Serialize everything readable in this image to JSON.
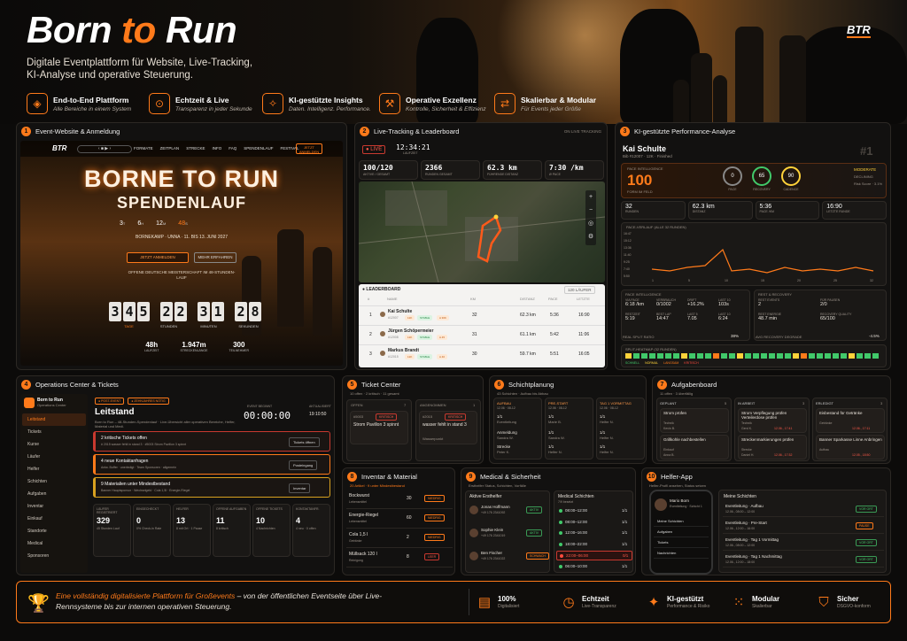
{
  "header": {
    "title_a": "Born ",
    "title_b": "to",
    "title_c": " Run",
    "subtitle": "Digitale Eventplattform für Website, Live-Tracking, KI-Analyse und operative Steuerung.",
    "logo": "BTR",
    "features": [
      {
        "icon": "layers-icon",
        "glyph": "◈",
        "title": "End-to-End Plattform",
        "sub": "Alle Bereiche in einem System"
      },
      {
        "icon": "live-icon",
        "glyph": "⊙",
        "title": "Echtzeit & Live",
        "sub": "Transparenz in jeder Sekunde"
      },
      {
        "icon": "ai-icon",
        "glyph": "✧",
        "title": "KI-gestützte Insights",
        "sub": "Daten. Intelligenz. Performance."
      },
      {
        "icon": "tools-icon",
        "glyph": "⚒",
        "title": "Operative Exzellenz",
        "sub": "Kontrolle, Sicherheit & Effizienz"
      },
      {
        "icon": "scale-icon",
        "glyph": "⇄",
        "title": "Skalierbar & Modular",
        "sub": "Für Events jeder Größe"
      }
    ]
  },
  "p1": {
    "num": "1",
    "title": "Event-Website & Anmeldung",
    "logo": "BTR",
    "nav": [
      "FORMATE",
      "ZEITPLAN",
      "STRECKE",
      "INFO",
      "FAQ",
      "SPENDENLAUF",
      "FESTIVAL"
    ],
    "nav_btn": "JETZT ANMELDEN",
    "hero1": "BORNE TO RUN",
    "hero2": "SPENDENLAUF",
    "countdown_top": [
      "3",
      "6",
      "12",
      "48"
    ],
    "countdown_top_units": [
      "T",
      "H",
      "M",
      "S"
    ],
    "place": "BORNEKAMP · UNNA · 11. BIS 13. JUNI 2027",
    "btn1": "JETZT ANMELDEN",
    "btn2": "MEHR ERFAHREN",
    "tag": "OFFENE DEUTSCHE MEISTERSCHAFT IM 48-STUNDEN-LAUF",
    "digits": [
      "3",
      "4",
      "5",
      "2",
      "2",
      "3",
      "1",
      "2",
      "8"
    ],
    "units": [
      "TAGE",
      "STUNDEN",
      "MINUTEN",
      "SEKUNDEN"
    ],
    "stats": [
      {
        "v": "48h",
        "l": "LAUFZEIT"
      },
      {
        "v": "1.947m",
        "l": "STRECKENLÄNGE"
      },
      {
        "v": "300",
        "l": "TEILNEHMER"
      }
    ]
  },
  "p2": {
    "num": "2",
    "title": "Live-Tracking & Leaderboard",
    "right": "ON LIVE TRACKING",
    "live": "● LIVE",
    "time": "12:34:21",
    "time_sub": "LAUFZEIT",
    "kpis": [
      {
        "v": "100/120",
        "l": "AKTIVE / GESAMT"
      },
      {
        "v": "2366",
        "l": "RUNDEN GESAMT"
      },
      {
        "v": "62.3 km",
        "l": "FÜHRENDE DISTANZ"
      },
      {
        "v": "7:30 /km",
        "l": "Ø PACE"
      }
    ],
    "lb_title": "● LEADERBOARD",
    "lb_count": "120 LÄUFER",
    "cols": [
      "#",
      "NAME",
      "KM",
      "DISTANZ",
      "PACE",
      "LETZTE"
    ],
    "rows": [
      {
        "rank": "1",
        "name": "Kai Schulte",
        "id": "#12007",
        "b1": "12K",
        "b2": "STABLE",
        "b3": "A 30K",
        "km": "32",
        "dist": "62.3 km",
        "pace": "5:36",
        "last": "16:90"
      },
      {
        "rank": "2",
        "name": "Jürgen Schöpermeier",
        "id": "#12008",
        "b1": "12K",
        "b2": "STABLE",
        "b3": "A 45",
        "km": "31",
        "dist": "61.1 km",
        "pace": "5:42",
        "last": "11:06"
      },
      {
        "rank": "3",
        "name": "Markus Brandt",
        "id": "#12015",
        "b1": "12K",
        "b2": "STABLE",
        "b3": "A 40",
        "km": "30",
        "dist": "59.7 km",
        "pace": "5:51",
        "last": "16:05"
      }
    ]
  },
  "p3": {
    "num": "3",
    "title": "KI-gestützte Performance-Analyse",
    "name": "Kai Schulte",
    "id": "Bib #12007 · 12K · Finished",
    "rank": "#1",
    "pi_label": "PACE INTELLIGENCE",
    "pi_val": "100",
    "pi_sub": "FORM IM FELD",
    "rings": [
      {
        "v": "0",
        "l": "PACE"
      },
      {
        "v": "65",
        "l": "RECOVERY"
      },
      {
        "v": "90",
        "l": "CADENCE"
      }
    ],
    "risk": "MODERATE",
    "risk_sub": "DECLINING",
    "risk_sub2": "Risk Score · 3.1%",
    "kpis": [
      {
        "v": "32",
        "l": "RUNDEN"
      },
      {
        "v": "62.3 km",
        "l": "DISTANZ"
      },
      {
        "v": "5:36",
        "l": "PACE /KM"
      },
      {
        "v": "16:90",
        "l": "LETZTE RUNDE"
      }
    ],
    "chart_title": "PACE-VERLAUF (ALLE 32 RUNDEN)",
    "yticks": [
      "16:47",
      "15:12",
      "13:36",
      "11:40",
      "9:25",
      "7:40",
      "5:50"
    ],
    "xticks": [
      "1",
      "5",
      "10",
      "15",
      "20",
      "25",
      "32"
    ],
    "box1_title": "PACE INTELLIGENCE",
    "box1": [
      {
        "l": "VIA PACE",
        "v": "6:18 /km"
      },
      {
        "l": "VERBRAUCH",
        "v": "0/1002"
      },
      {
        "l": "DRIFT",
        "v": "+16.2%"
      },
      {
        "l": "LAST 10",
        "v": "103s"
      },
      {
        "l": "RESTZEIT",
        "v": "5:19"
      },
      {
        "l": "BEST LAP",
        "v": "14:47"
      },
      {
        "l": "LAST 5",
        "v": "7.05"
      },
      {
        "l": "LAST 10",
        "v": "6:24"
      }
    ],
    "box2_title": "REST & RECOVERY",
    "box2": [
      {
        "l": "REST EVENTS",
        "v": "2"
      },
      {
        "l": "FÜR PAUSEN",
        "v": "2/0"
      },
      {
        "l": "REST ENERGIE",
        "v": "48.7 min"
      },
      {
        "l": "RECOVERY QUALITY",
        "v": "65/100"
      }
    ],
    "foot1": "REAL SPLIT RATIO",
    "foot1v": "38%",
    "foot2": "AVG RECOVERY DEGRADE",
    "foot2v": "-4.5%",
    "heat_title": "SPLIT-HEATMAP (32 RUNDEN)",
    "heat_legend": [
      "SCHNELL",
      "NORMAL",
      "LANGSAM",
      "KRITISCH"
    ]
  },
  "p4": {
    "num": "4",
    "title": "Operations Center & Tickets",
    "brand": "Born to Run",
    "brand_sub": "Operations Center",
    "nav": [
      "Leitstand",
      "Tickets",
      "Kurse",
      "Läufer",
      "Helfer",
      "Schichten",
      "Aufgaben",
      "Inventar",
      "Einkauf",
      "Standorte",
      "Medical",
      "Sponsoren"
    ],
    "tags": [
      "● POST-EVENT",
      "● ZEHNJAHRES NÖTIG"
    ],
    "head": "Leitstand",
    "desc": "Born to Run – 48-Stunden-Spendenlauf · Live-Übersicht aller operativen Bereiche, Helfer, Material und Medi.",
    "clock_l": "EVENT BEGINNT",
    "clock": "00:00:00",
    "clock_r": "AKTUALISIERT",
    "clock_r2": "19:10:50",
    "alerts": [
      {
        "t": "2 kritische Tickets offen",
        "s": "# 2015 wasser fehlt in stand 3 · #5003 Strom Pavillon 3 spinnt",
        "b": "Tickets öffnen",
        "c": "#c8392f"
      },
      {
        "t": "4 neue Kontaktanfragen",
        "s": "Antw. Buffer · unerledigt · Team Sponsoren · allgemein",
        "b": "Posteingang",
        "c": "#ff7a1a"
      },
      {
        "t": "9 Materialien unter Mindestbestand",
        "s": "Banner Hauptsponsor · Wechselgeld · Cola 1,5l · Energie-Riegel",
        "b": "Inventar",
        "c": "#d9a11f"
      }
    ],
    "stats": [
      {
        "l": "LÄUFER REGISTRIERT",
        "v": "329",
        "s": "45 Stunden Lauf"
      },
      {
        "l": "EINGECHECKT",
        "v": "0",
        "s": "0% Check-in Rate"
      },
      {
        "l": "HELFER",
        "v": "13",
        "s": "8 mit Ort · 1 Pause"
      },
      {
        "l": "OFFENE AUFGABEN",
        "v": "11",
        "s": "8 kritisch"
      },
      {
        "l": "OFFENE TICKETS",
        "v": "10",
        "s": "4 Nachrichten"
      },
      {
        "l": "KONTAKTANFR.",
        "v": "4",
        "s": "4 neu · 0 offen"
      }
    ]
  },
  "p5": {
    "num": "5",
    "title": "Ticket Center",
    "sub": "10 offen · 2 kritisch · 11 gesamt",
    "c1": "OFFEN",
    "c1n": "7",
    "c2": "ANGENOMMEN",
    "c2n": "1",
    "t1id": "#5003",
    "t1b": "KRITISCH",
    "t1": "Strom Pavillon 3 spinnt",
    "t2id": "#2015",
    "t2b": "KRITISCH",
    "t2": "wasser fehlt in stand 3",
    "t2s": "Wasserpunkt"
  },
  "p6": {
    "num": "6",
    "title": "Schichtplanung",
    "sub": "43 Schichten · Aufbau bis Abbau",
    "cols": [
      {
        "h": "AUFBAU",
        "d": "12.06 · 08-12",
        "n": "1/1",
        "w": "Eventleitung",
        "ws": "Peters M."
      },
      {
        "h": "PRE-START",
        "d": "12.06 · 08-12",
        "n": "1/1",
        "w": "Marie B.",
        "ws": ""
      },
      {
        "h": "TAG 1 VORMITTAG",
        "d": "12.06 · 08-12",
        "n": "1/1",
        "w": "Helfer N.",
        "ws": ""
      }
    ],
    "r2": [
      {
        "w": "Anmeldung",
        "s": "Sandra W."
      },
      {
        "w": "1/1",
        "s": "Sandra W."
      },
      {
        "w": "1/1",
        "s": "Helfer N."
      }
    ],
    "r3": [
      {
        "w": "Strecke",
        "s": "Peter K."
      },
      {
        "w": "1/1",
        "s": "Helfer N."
      },
      {
        "w": "1/1",
        "s": "Helfer N."
      }
    ]
  },
  "p7": {
    "num": "7",
    "title": "Aufgabenboard",
    "sub": "11 offen · 3 überfällig",
    "cols": [
      {
        "h": "GEPLANT",
        "n": "5",
        "items": [
          {
            "t": "Strom prüfen",
            "s": "Technik",
            "p": "Kevin B."
          },
          {
            "t": "Grillkohle nachbestellen",
            "s": "Einkauf",
            "p": "Anna B."
          }
        ]
      },
      {
        "h": "IN ARBEIT",
        "n": "3",
        "items": [
          {
            "t": "Strom Verpflegung prüfen Verteilerdose prüfen",
            "s": "Technik",
            "p": "Gerd K.",
            "d": "12.06., 17:41"
          },
          {
            "t": "Streckenmarkierungen prüfen",
            "s": "Strecke",
            "p": "Daniel H.",
            "d": "12.06., 17:32"
          }
        ]
      },
      {
        "h": "ERLEDIGT",
        "n": "3",
        "items": [
          {
            "t": "Eisbestand für Getränke",
            "s": "Getränke",
            "p": "",
            "d": "12.06., 17:11"
          },
          {
            "t": "Banner Sparkasse Linne Anbringen",
            "s": "Aufbau",
            "p": "",
            "d": "12.05., 18:50"
          }
        ]
      }
    ]
  },
  "p8": {
    "num": "8",
    "title": "Inventar & Material",
    "sub": "20 Artikel · 9 unter Mindestbestand",
    "items": [
      {
        "n": "Bockwurst",
        "s": "Lebensmittel",
        "v": "30",
        "b": "NIEDRIG"
      },
      {
        "n": "Energie-Riegel",
        "s": "Lebensmittel",
        "v": "60",
        "b": "NIEDRIG"
      },
      {
        "n": "Cola 1,5 l",
        "s": "Getränke",
        "v": "2",
        "b": "NIEDRIG"
      },
      {
        "n": "Müllsack 120 l",
        "s": "Reinigung",
        "v": "8",
        "b": "LEER"
      }
    ]
  },
  "p9": {
    "num": "9",
    "title": "Medical & Sicherheit",
    "sub": "Ersthelfer Status, Schichten, Vorfälle",
    "left_h": "Aktive Ersthelfer",
    "people": [
      {
        "n": "Jonas Hoffmann",
        "p": "+49 176 2341092",
        "b": "AKTIV"
      },
      {
        "n": "Sophie Klein",
        "p": "+49 176 2341019",
        "b": "AKTIV"
      },
      {
        "n": "Ben Fischer",
        "p": "+49 176 2341022",
        "b": "SCHWACH"
      }
    ],
    "right_h": "Medical Schichten",
    "right_sub": "7/9 besetzt",
    "shifts": [
      {
        "t": "08:00–12:00",
        "v": "1/1"
      },
      {
        "t": "08:00–12:00",
        "v": "1/1"
      },
      {
        "t": "12:00–16:00",
        "v": "1/1"
      },
      {
        "t": "18:00–22:00",
        "v": "1/1"
      },
      {
        "t": "22:00–06:00",
        "v": "0/1"
      },
      {
        "t": "06:00–10:00",
        "v": "1/1"
      }
    ]
  },
  "p10": {
    "num": "10",
    "title": "Helfer-App",
    "sub": "Helfer-Profil ansehen, Status setzen",
    "phone_name": "Mario Born",
    "phone_sub": "Eventleitung · Schicht 1",
    "phone_menu": [
      "Meine Schichten",
      "Aufgaben",
      "Tickets",
      "Nachrichten"
    ],
    "list_h": "Meine Schichten",
    "shifts": [
      {
        "t": "Eventleitung · Aufbau",
        "d": "12.06., 08:00 – 12:00",
        "b": "VOR ORT"
      },
      {
        "t": "Eventleitung · Pre-Start",
        "d": "12.06., 12:00 – 16:00",
        "b": "PAUSE"
      },
      {
        "t": "Eventleitung · Tag 1 Vormittag",
        "d": "12.06., 08:00 – 12:00",
        "b": "VOR ORT"
      },
      {
        "t": "Eventleitung · Tag 1 Nachmittag",
        "d": "12.06., 12:00 – 18:00",
        "b": "VOR ORT"
      }
    ]
  },
  "footer": {
    "text_a": "Eine vollständig digitalisierte Plattform für Großevents",
    "text_b": " – von der öffentlichen Eventseite über Live-Rennsysteme bis zur internen operativen Steuerung.",
    "items": [
      {
        "icon": "document-icon",
        "glyph": "▤",
        "t": "100%",
        "s": "Digitalisiert"
      },
      {
        "icon": "clock-icon",
        "glyph": "◷",
        "t": "Echtzeit",
        "s": "Live-Transparenz"
      },
      {
        "icon": "sparkle-icon",
        "glyph": "✦",
        "t": "KI-gestützt",
        "s": "Performance & Risiko"
      },
      {
        "icon": "modules-icon",
        "glyph": "⁙",
        "t": "Modular",
        "s": "Skalierbar"
      },
      {
        "icon": "shield-icon",
        "glyph": "⛉",
        "t": "Sicher",
        "s": "DSGVO-konform"
      }
    ]
  }
}
